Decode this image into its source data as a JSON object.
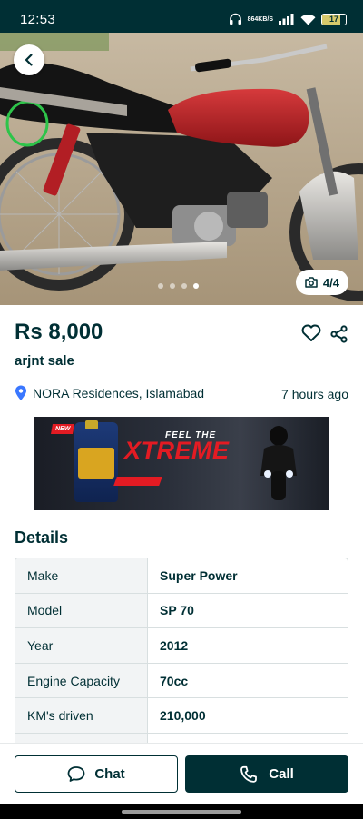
{
  "status_bar": {
    "time": "12:53",
    "net_speed_value": "864",
    "net_speed_unit": "KB/S",
    "battery": "17",
    "battery_level": 0.17
  },
  "gallery": {
    "counter": "4/4",
    "total": 4,
    "current": 4
  },
  "listing": {
    "price": "Rs 8,000",
    "title": "arjnt sale",
    "location": "NORA Residences, Islamabad",
    "posted": "7 hours ago"
  },
  "ad": {
    "badge": "NEW",
    "tagline": "FEEL THE",
    "headline": "XTREME"
  },
  "details": {
    "heading": "Details",
    "rows": [
      {
        "label": "Make",
        "value": "Super Power"
      },
      {
        "label": "Model",
        "value": "SP 70"
      },
      {
        "label": "Year",
        "value": "2012"
      },
      {
        "label": "Engine Capacity",
        "value": "70cc"
      },
      {
        "label": "KM's driven",
        "value": "210,000"
      }
    ]
  },
  "actions": {
    "chat_label": "Chat",
    "call_label": "Call"
  },
  "colors": {
    "brand_dark": "#002f34",
    "accent_blue": "#3a77ff",
    "bike_red": "#c0262a"
  }
}
